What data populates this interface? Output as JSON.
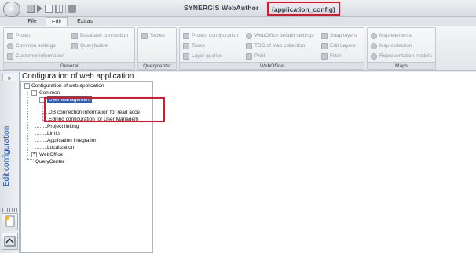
{
  "window": {
    "title": "SYNERGIS WebAuthor",
    "config_name": "(application_config)"
  },
  "tabs": [
    "File",
    "Edit",
    "Extras"
  ],
  "ribbon": {
    "general": {
      "label": "General",
      "items": [
        "Project",
        "Common settings",
        "Customer information",
        "Database connection",
        "Querybuilder"
      ]
    },
    "querycenter": {
      "label": "Querycenter",
      "items": [
        "Tables"
      ]
    },
    "weboffice": {
      "label": "WebOffice",
      "items": [
        "Project configuration",
        "Tasks",
        "Layer queries",
        "WebOffice default settings",
        "TOC of Map collection",
        "Print",
        "Snap layers",
        "Edit Layers",
        "Filter"
      ]
    },
    "maps": {
      "label": "Maps",
      "items": [
        "Map elements",
        "Map collection",
        "Representation models"
      ]
    }
  },
  "sidebar": {
    "collapse": "»",
    "label": "Edit configuration"
  },
  "content": {
    "title": "Configuration of web application",
    "tree": [
      "Configuration of web application",
      "Common",
      "User Management",
      "DB connection information for read acce",
      "Editing configuration for User Managem",
      "Project linking",
      "Limits",
      "Application integration",
      "Localization",
      "WebOffice",
      "QueryCenter"
    ]
  },
  "colors": {
    "accent": "#2f5eb8",
    "highlight": "#e1162b"
  }
}
